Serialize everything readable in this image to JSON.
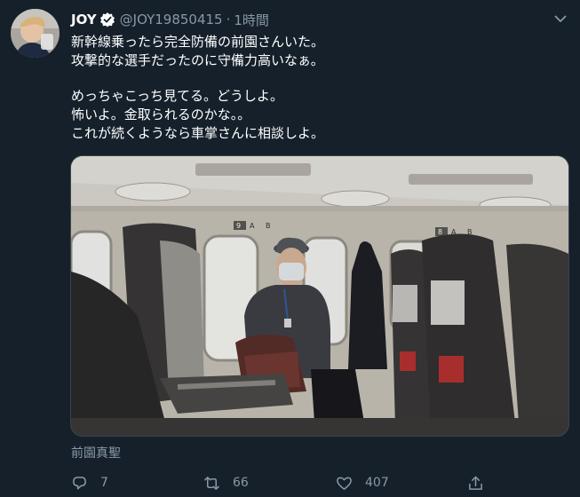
{
  "user": {
    "display_name": "JOY",
    "handle": "@JOY19850415",
    "separator": "·",
    "timestamp": "1時間",
    "avatar_icon": "user-avatar",
    "verified_icon": "verified-badge-icon"
  },
  "tweet": {
    "lines": [
      "新幹線乗ったら完全防備の前園さんいた。",
      "攻撃的な選手だったのに守備力高いなぁ。",
      "めっちゃこっち見てる。どうしよ。",
      "怖いよ。金取られるのかな。。",
      "これが続くようなら車掌さんに相談しよ。"
    ]
  },
  "media": {
    "caption": "前園真聖",
    "seat_labels": [
      "9",
      "A",
      "B",
      "8",
      "A",
      "B"
    ]
  },
  "actions": {
    "reply": {
      "icon": "reply-icon",
      "count": "7"
    },
    "retweet": {
      "icon": "retweet-icon",
      "count": "66"
    },
    "like": {
      "icon": "heart-icon",
      "count": "407"
    },
    "share": {
      "icon": "share-icon",
      "count": ""
    }
  },
  "colors": {
    "background": "#15202b",
    "text_primary": "#ffffff",
    "text_secondary": "#8899a6",
    "verified": "#ffffff"
  }
}
